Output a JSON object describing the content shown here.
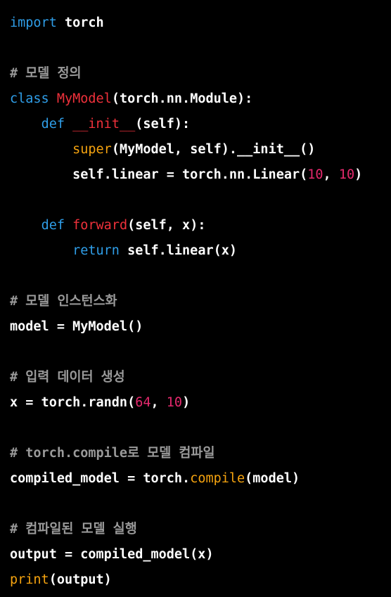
{
  "colors": {
    "background": "#000000",
    "text": "#ffffff",
    "keyword": "#2f9ee8",
    "class_name": "#f0313b",
    "function_name": "#f0313b",
    "builtin": "#f5a30f",
    "number": "#e5296d",
    "comment": "#9a9a9a"
  },
  "code": {
    "language": "python",
    "lines": [
      [
        {
          "t": "keyword",
          "v": "import"
        },
        {
          "t": "text",
          "v": " torch"
        }
      ],
      [],
      [
        {
          "t": "comment",
          "v": "# 모델 정의"
        }
      ],
      [
        {
          "t": "keyword",
          "v": "class"
        },
        {
          "t": "text",
          "v": " "
        },
        {
          "t": "class-name",
          "v": "MyModel"
        },
        {
          "t": "text",
          "v": "(torch.nn.Module):"
        }
      ],
      [
        {
          "t": "text",
          "v": "    "
        },
        {
          "t": "def-keyword",
          "v": "def"
        },
        {
          "t": "text",
          "v": " "
        },
        {
          "t": "func-name",
          "v": "__init__"
        },
        {
          "t": "text",
          "v": "(self):"
        }
      ],
      [
        {
          "t": "text",
          "v": "        "
        },
        {
          "t": "builtin",
          "v": "super"
        },
        {
          "t": "text",
          "v": "(MyModel, self).__init__()"
        }
      ],
      [
        {
          "t": "text",
          "v": "        self.linear = torch.nn.Linear("
        },
        {
          "t": "number",
          "v": "10"
        },
        {
          "t": "text",
          "v": ", "
        },
        {
          "t": "number",
          "v": "10"
        },
        {
          "t": "text",
          "v": ")"
        }
      ],
      [],
      [
        {
          "t": "text",
          "v": "    "
        },
        {
          "t": "def-keyword",
          "v": "def"
        },
        {
          "t": "text",
          "v": " "
        },
        {
          "t": "func-name",
          "v": "forward"
        },
        {
          "t": "text",
          "v": "(self, x):"
        }
      ],
      [
        {
          "t": "text",
          "v": "        "
        },
        {
          "t": "keyword",
          "v": "return"
        },
        {
          "t": "text",
          "v": " self.linear(x)"
        }
      ],
      [],
      [
        {
          "t": "comment",
          "v": "# 모델 인스턴스화"
        }
      ],
      [
        {
          "t": "text",
          "v": "model = MyModel()"
        }
      ],
      [],
      [
        {
          "t": "comment",
          "v": "# 입력 데이터 생성"
        }
      ],
      [
        {
          "t": "text",
          "v": "x = torch.randn("
        },
        {
          "t": "number",
          "v": "64"
        },
        {
          "t": "text",
          "v": ", "
        },
        {
          "t": "number",
          "v": "10"
        },
        {
          "t": "text",
          "v": ")"
        }
      ],
      [],
      [
        {
          "t": "comment",
          "v": "# torch.compile로 모델 컴파일"
        }
      ],
      [
        {
          "t": "text",
          "v": "compiled_model = torch."
        },
        {
          "t": "builtin",
          "v": "compile"
        },
        {
          "t": "text",
          "v": "(model)"
        }
      ],
      [],
      [
        {
          "t": "comment",
          "v": "# 컴파일된 모델 실행"
        }
      ],
      [
        {
          "t": "text",
          "v": "output = compiled_model(x)"
        }
      ],
      [
        {
          "t": "builtin",
          "v": "print"
        },
        {
          "t": "text",
          "v": "(output)"
        }
      ]
    ]
  }
}
